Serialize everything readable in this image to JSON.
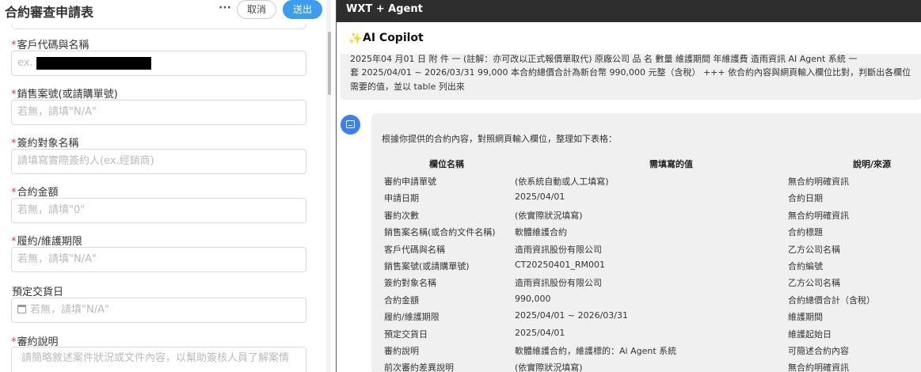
{
  "form": {
    "title": "合約審查申請表",
    "more_label": "···",
    "cancel_label": "取消",
    "submit_label": "送出",
    "fields": [
      {
        "required": "*",
        "label": "客戶代碼與名稱",
        "placeholder": "ex."
      },
      {
        "required": "*",
        "label": "銷售案號(或請購單號)",
        "placeholder": "若無，請填\"N/A\""
      },
      {
        "required": "*",
        "label": "簽約對象名稱",
        "placeholder": "請填寫實際簽約人(ex.經銷商)"
      },
      {
        "required": "*",
        "label": "合約金額",
        "placeholder": "若無，請填\"0\""
      },
      {
        "required": "*",
        "label": "履約/維護期限",
        "placeholder": "若無，請填\"N/A\""
      },
      {
        "required": "",
        "label": "預定交貨日",
        "placeholder": "若無，請填\"N/A\""
      },
      {
        "required": "*",
        "label": "審約說明",
        "placeholder": "請簡略敘述案件狀況或文件內容，以幫助簽核人員了解案情"
      }
    ]
  },
  "agent": {
    "window_title": "WXT + Agent",
    "copilot_title": "AI Copilot",
    "user_message": {
      "line1": "2025年04    月01    日 附        件 一 (註解：亦可改以正式報價單取代) 原廠公司 品            名 數量 維護期間 年維護費 造雨資訊 AI Agent 系統 一",
      "line2": "套 2025/04/01 ~ 2026/03/31 99,000 本合約總價合計為新台幣 990,000 元整（含稅） +++ 依合約內容與網頁輸入欄位比對，判斷出各欄位",
      "line3": "需要的值，並以 table 列出來"
    },
    "reply": {
      "intro": "根據你提供的合約內容，對照網頁輸入欄位，整理如下表格：",
      "headers": [
        "欄位名稱",
        "需填寫的值",
        "說明/來源"
      ],
      "rows": [
        [
          "審約申請單號",
          "(依系統自動或人工填寫)",
          "無合約明確資訊"
        ],
        [
          "申請日期",
          "2025/04/01",
          "合約日期"
        ],
        [
          "審約次數",
          "(依實際狀況填寫)",
          "無合約明確資訊"
        ],
        [
          "銷售案名稱(或合約文件名稱)",
          "軟體維護合約",
          "合約標題"
        ],
        [
          "客戶代碼與名稱",
          "造雨資訊股份有限公司",
          "乙方公司名稱"
        ],
        [
          "銷售案號(或請購單號)",
          "CT20250401_RM001",
          "合約編號"
        ],
        [
          "簽約對象名稱",
          "造雨資訊股份有限公司",
          "乙方公司名稱"
        ],
        [
          "合約金額",
          "990,000",
          "合約總價合計（含稅）"
        ],
        [
          "履約/維護期限",
          "2025/04/01 ~ 2026/03/31",
          "維護期間"
        ],
        [
          "預定交貨日",
          "2025/04/01",
          "維護起始日"
        ],
        [
          "審約說明",
          "軟體維護合約，維護標的：Ai Agent 系統",
          "可簡述合約內容"
        ],
        [
          "前次審約差異說明",
          "(依實際狀況填寫)",
          "無合約明確資訊"
        ]
      ]
    }
  },
  "colors": {
    "accent": "#3b9cf0",
    "required": "#e53935",
    "titlebar": "#2e2e2e",
    "bubble": "#f0f0f0",
    "avatar": "#3b7ff0",
    "sparkle": "#f0b400"
  },
  "icons": [
    "more-icon",
    "calendar-icon",
    "sparkle-icon",
    "bot-avatar-icon"
  ]
}
